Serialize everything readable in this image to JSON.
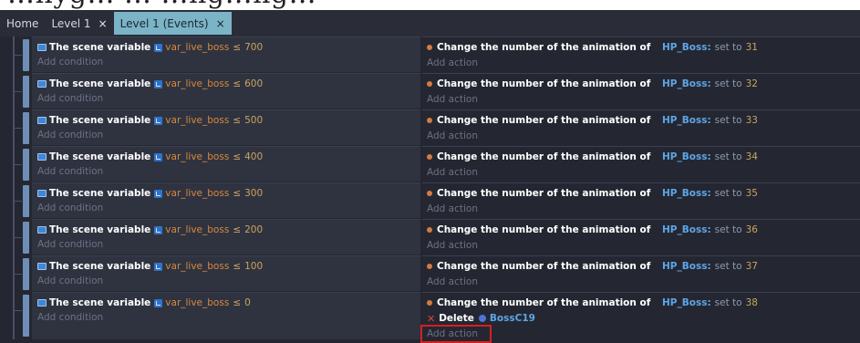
{
  "header_fragment": "…nyg… … …ng…ng…",
  "tabs": [
    {
      "label": "Home",
      "closable": false,
      "active": false
    },
    {
      "label": "Level 1",
      "closable": true,
      "active": false
    },
    {
      "label": "Level 1 (Events)",
      "closable": true,
      "active": true
    }
  ],
  "tab_close_glyph": "×",
  "events": [
    {
      "condition": {
        "prefix": "The scene variable",
        "variable": "var_live_boss",
        "operator": "≤",
        "value": "700"
      },
      "add_condition": "Add condition",
      "actions": [
        {
          "text": "Change the number of the animation of",
          "object": "HP_Boss:",
          "op": "set to",
          "value": "31"
        }
      ],
      "add_action": "Add action"
    },
    {
      "condition": {
        "prefix": "The scene variable",
        "variable": "var_live_boss",
        "operator": "≤",
        "value": "600"
      },
      "add_condition": "Add condition",
      "actions": [
        {
          "text": "Change the number of the animation of",
          "object": "HP_Boss:",
          "op": "set to",
          "value": "32"
        }
      ],
      "add_action": "Add action"
    },
    {
      "condition": {
        "prefix": "The scene variable",
        "variable": "var_live_boss",
        "operator": "≤",
        "value": "500"
      },
      "add_condition": "Add condition",
      "actions": [
        {
          "text": "Change the number of the animation of",
          "object": "HP_Boss:",
          "op": "set to",
          "value": "33"
        }
      ],
      "add_action": "Add action"
    },
    {
      "condition": {
        "prefix": "The scene variable",
        "variable": "var_live_boss",
        "operator": "≤",
        "value": "400"
      },
      "add_condition": "Add condition",
      "actions": [
        {
          "text": "Change the number of the animation of",
          "object": "HP_Boss:",
          "op": "set to",
          "value": "34"
        }
      ],
      "add_action": "Add action"
    },
    {
      "condition": {
        "prefix": "The scene variable",
        "variable": "var_live_boss",
        "operator": "≤",
        "value": "300"
      },
      "add_condition": "Add condition",
      "actions": [
        {
          "text": "Change the number of the animation of",
          "object": "HP_Boss:",
          "op": "set to",
          "value": "35"
        }
      ],
      "add_action": "Add action"
    },
    {
      "condition": {
        "prefix": "The scene variable",
        "variable": "var_live_boss",
        "operator": "≤",
        "value": "200"
      },
      "add_condition": "Add condition",
      "actions": [
        {
          "text": "Change the number of the animation of",
          "object": "HP_Boss:",
          "op": "set to",
          "value": "36"
        }
      ],
      "add_action": "Add action"
    },
    {
      "condition": {
        "prefix": "The scene variable",
        "variable": "var_live_boss",
        "operator": "≤",
        "value": "100"
      },
      "add_condition": "Add condition",
      "actions": [
        {
          "text": "Change the number of the animation of",
          "object": "HP_Boss:",
          "op": "set to",
          "value": "37"
        }
      ],
      "add_action": "Add action"
    },
    {
      "condition": {
        "prefix": "The scene variable",
        "variable": "var_live_boss",
        "operator": "≤",
        "value": "0"
      },
      "add_condition": "Add condition",
      "actions": [
        {
          "text": "Change the number of the animation of",
          "object": "HP_Boss:",
          "op": "set to",
          "value": "38"
        },
        {
          "type": "delete",
          "text": "Delete",
          "object": "BossC19"
        }
      ],
      "add_action": "Add action"
    }
  ],
  "colors": {
    "sheet_bg": "#242731",
    "condition_bg": "#2f3340",
    "tab_active_bg": "#7ab4c6",
    "variable_orange": "#d7893e",
    "object_blue": "#5ea5e6",
    "highlight_red": "#d81e1e"
  },
  "icons": {
    "scene_variable": "scene-variable-icon",
    "variable": "variable-icon",
    "action_bullet": "action-bullet-icon",
    "delete": "delete-x-icon",
    "object": "object-icon"
  }
}
